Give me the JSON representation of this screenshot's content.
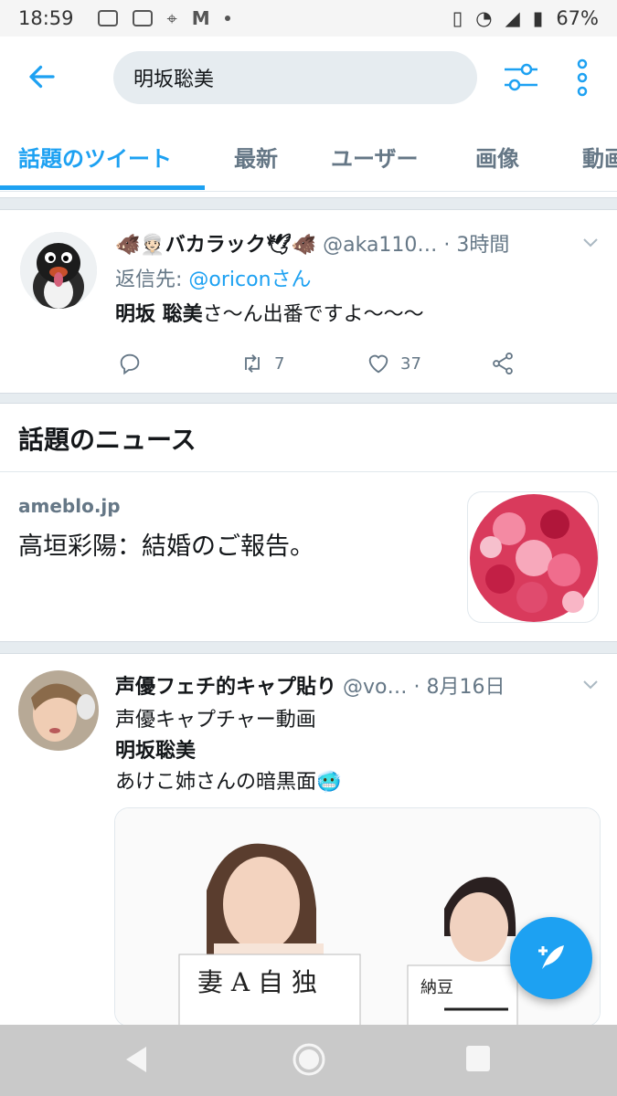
{
  "status_bar": {
    "time": "18:59",
    "battery": "67%"
  },
  "search": {
    "query": "明坂聡美"
  },
  "tabs": [
    {
      "label": "話題のツイート",
      "active": true
    },
    {
      "label": "最新"
    },
    {
      "label": "ユーザー"
    },
    {
      "label": "画像"
    },
    {
      "label": "動画"
    }
  ],
  "tweet1": {
    "name": "🐗👳🏻バカラック🕊🐗",
    "handle": "@aka110…",
    "time": "· 3時間",
    "reply_prefix": "返信先: ",
    "reply_to": "@oriconさん",
    "text_bold": "明坂 聡美",
    "text_rest": "さ〜ん出番ですよ〜〜〜",
    "retweets": "7",
    "likes": "37"
  },
  "news": {
    "section_title": "話題のニュース",
    "source": "ameblo.jp",
    "headline": "高垣彩陽：結婚のご報告。"
  },
  "tweet2": {
    "name": "声優フェチ的キャプ貼り",
    "handle": "@vo…",
    "time": "· 8月16日",
    "line1": "声優キャプチャー動画",
    "line2": "明坂聡美",
    "line3": "あけこ姉さんの暗黒面🥶"
  },
  "colors": {
    "accent": "#1da1f2",
    "muted": "#657786",
    "separator": "#e6ecf0"
  }
}
